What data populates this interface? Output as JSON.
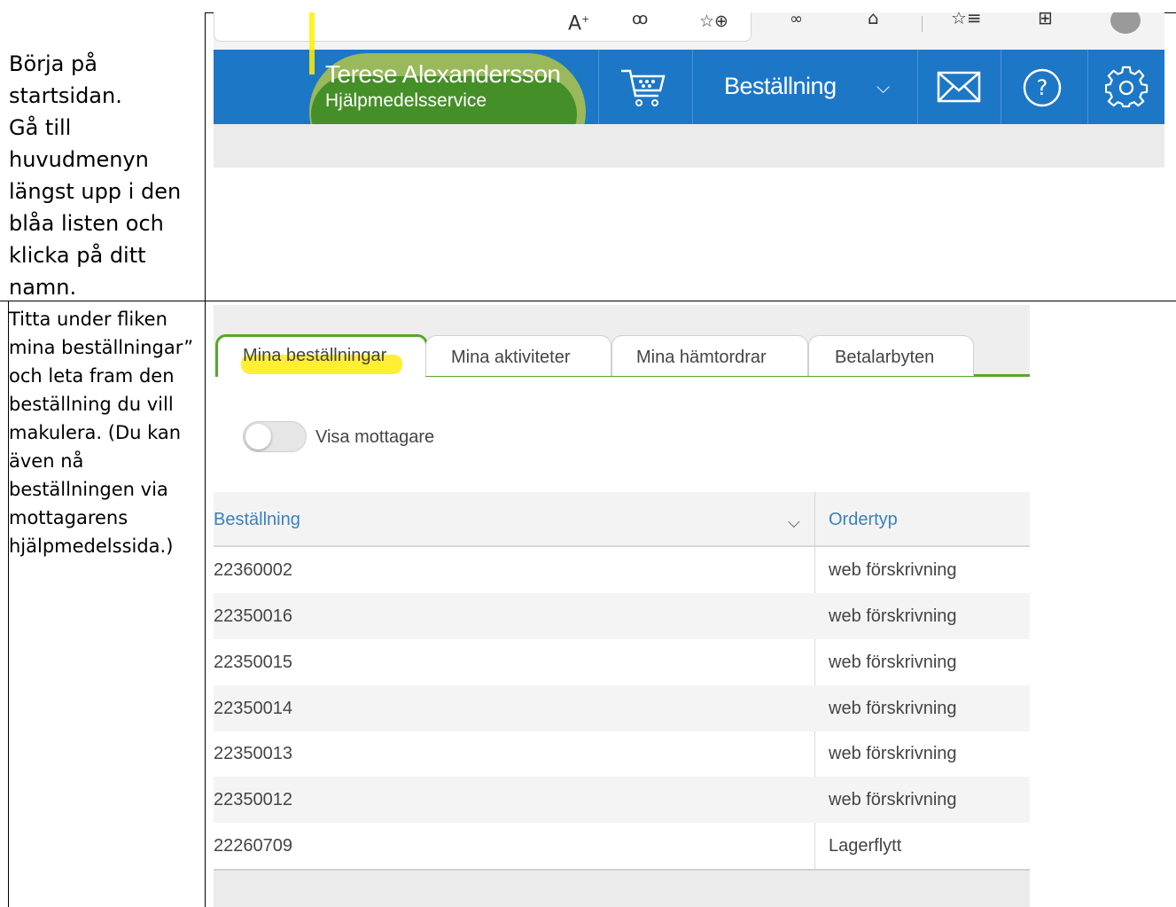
{
  "instructions": {
    "step1": [
      "Börja på",
      "startsidan.",
      "Gå till",
      "huvudmenyn",
      "längst upp i den",
      "blåa listen och",
      "klicka på ditt",
      "namn."
    ],
    "step2": [
      "Titta under fliken",
      "mina beställningar”",
      "och leta fram den",
      "beställning du vill",
      "makulera. (Du kan",
      "även nå",
      "beställningen via",
      "mottagarens",
      "hjälpmedelssida.)"
    ]
  },
  "header": {
    "user_name": "Terese Alexandersson",
    "user_org": "Hjälpmedelsservice",
    "menu_label": "Beställning",
    "colors": {
      "bar": "#1d77c7",
      "highlight_yellow": "#fff000",
      "highlight_green": "#006e00"
    }
  },
  "tabs": [
    {
      "label": "Mina beställningar",
      "active": true
    },
    {
      "label": "Mina aktiviteter",
      "active": false
    },
    {
      "label": "Mina hämtordrar",
      "active": false
    },
    {
      "label": "Betalarbyten",
      "active": false
    }
  ],
  "toggle": {
    "label": "Visa mottagare",
    "on": false
  },
  "table": {
    "columns": [
      "Beställning",
      "Ordertyp"
    ],
    "rows": [
      [
        "22360002",
        "web förskrivning"
      ],
      [
        "22350016",
        "web förskrivning"
      ],
      [
        "22350015",
        "web förskrivning"
      ],
      [
        "22350014",
        "web förskrivning"
      ],
      [
        "22350013",
        "web förskrivning"
      ],
      [
        "22350012",
        "web förskrivning"
      ],
      [
        "22260709",
        "Lagerflytt"
      ]
    ]
  },
  "colors": {
    "tab_active_border": "#5aa52a",
    "column_header": "#3a80c0"
  }
}
